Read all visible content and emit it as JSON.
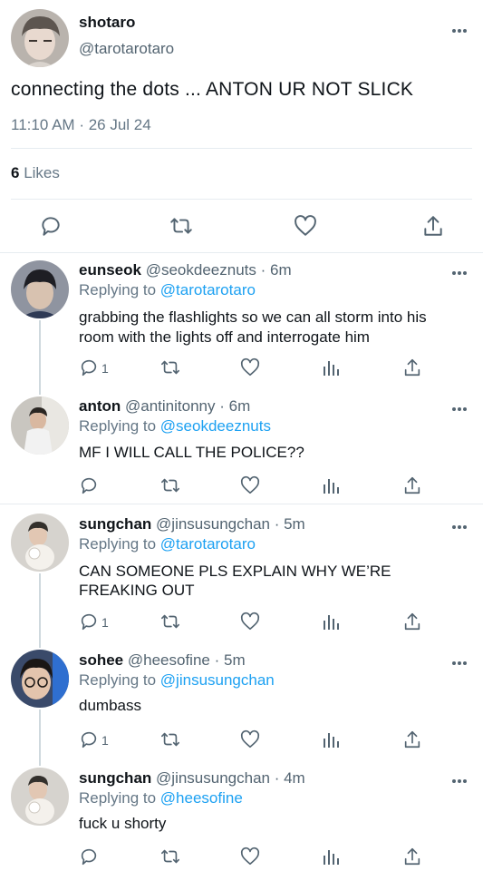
{
  "main": {
    "author_name": "shotaro",
    "author_handle": "@tarotarotaro",
    "text": "connecting the dots ... ANTON UR NOT SLICK",
    "time": "11:10 AM",
    "date_sep": "·",
    "date": "26 Jul 24",
    "likes_count": "6",
    "likes_label": "Likes"
  },
  "replies": [
    {
      "name": "eunseok",
      "handle": "@seokdeeznuts",
      "time": "· 6m",
      "replying_label": "Replying to",
      "replying_to": "@tarotarotaro",
      "line1": "grabbing the flashlights so we can all storm into his",
      "line2": "room with the lights off and interrogate him",
      "reply_count": "1"
    },
    {
      "name": "anton",
      "handle": "@antinitonny",
      "time": "· 6m",
      "replying_label": "Replying to",
      "replying_to": "@seokdeeznuts",
      "line1": "MF I WILL CALL THE POLICE??",
      "reply_count": ""
    },
    {
      "name": "sungchan",
      "handle": "@jinsusungchan",
      "time": "· 5m",
      "replying_label": "Replying to",
      "replying_to": "@tarotarotaro",
      "line1": "CAN SOMEONE PLS EXPLAIN WHY WE’RE",
      "line2": "FREAKING OUT",
      "reply_count": "1"
    },
    {
      "name": "sohee",
      "handle": "@heesofine",
      "time": "· 5m",
      "replying_label": "Replying to",
      "replying_to": "@jinsusungchan",
      "line1": "dumbass",
      "reply_count": "1"
    },
    {
      "name": "sungchan",
      "handle": "@jinsusungchan",
      "time": "· 4m",
      "replying_label": "Replying to",
      "replying_to": "@heesofine",
      "line1": "fuck u shorty",
      "reply_count": ""
    }
  ],
  "icons": {
    "reply": "reply-icon",
    "retweet": "retweet-icon",
    "like": "heart-icon",
    "share": "share-icon",
    "analytics": "analytics-icon",
    "more": "more-icon"
  },
  "colors": {
    "link": "#1da1f2",
    "secondary": "#657786",
    "divider": "#e6ecf0"
  }
}
